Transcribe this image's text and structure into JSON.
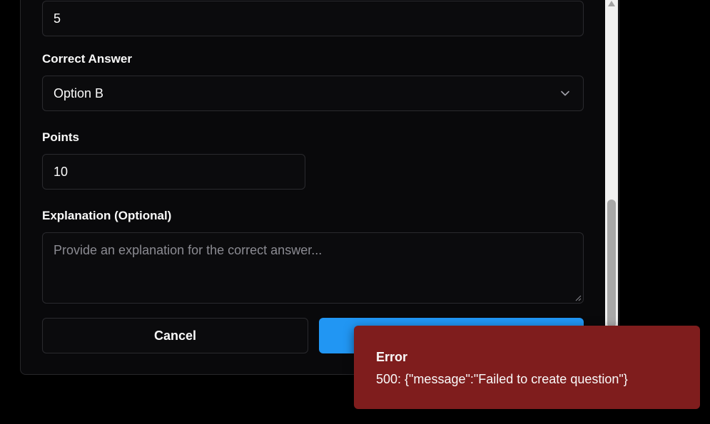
{
  "form": {
    "top_input_value": "5",
    "correct_answer": {
      "label": "Correct Answer",
      "selected": "Option B"
    },
    "points": {
      "label": "Points",
      "value": "10"
    },
    "explanation": {
      "label": "Explanation (Optional)",
      "placeholder": "Provide an explanation for the correct answer..."
    },
    "cancel_label": "Cancel",
    "submit_label": ""
  },
  "toast": {
    "title": "Error",
    "message": "500: {\"message\":\"Failed to create question\"}"
  },
  "colors": {
    "background": "#000000",
    "card": "#09090b",
    "primary": "#2196f3",
    "toast_error": "#7f1d1d"
  },
  "icons": {
    "select": "chevron-down-icon",
    "scroll_up": "arrow-up-icon"
  }
}
